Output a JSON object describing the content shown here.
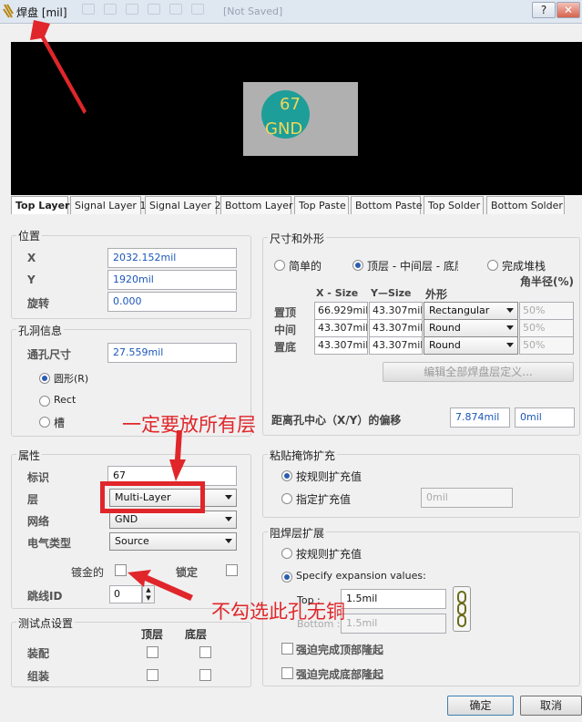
{
  "window": {
    "title": "焊盘 [mil]",
    "ghost_text": "[Not Saved]",
    "help": "?",
    "close": "✕"
  },
  "preview": {
    "designator": "67",
    "net": "GND"
  },
  "tabs": [
    "Top Layer",
    "Signal Layer 1",
    "Signal Layer 2",
    "Bottom Layer",
    "Top Paste",
    "Bottom Paste",
    "Top Solder",
    "Bottom Solder"
  ],
  "position": {
    "title": "位置",
    "x_label": "X",
    "x_value": "2032.152mil",
    "y_label": "Y",
    "y_value": "1920mil",
    "rot_label": "旋转",
    "rot_value": "0.000"
  },
  "hole": {
    "title": "孔洞信息",
    "size_label": "通孔尺寸",
    "size_value": "27.559mil",
    "shapes": [
      "圆形(R)",
      "Rect",
      "槽"
    ]
  },
  "props": {
    "title": "属性",
    "designator_label": "标识",
    "designator_value": "67",
    "layer_label": "层",
    "layer_value": "Multi-Layer",
    "net_label": "网络",
    "net_value": "GND",
    "etype_label": "电气类型",
    "etype_value": "Source",
    "plated_label": "镀金的",
    "locked_label": "锁定",
    "jumper_label": "跳线ID",
    "jumper_value": "0"
  },
  "testpoint": {
    "title": "测试点设置",
    "top_col": "顶层",
    "bottom_col": "底层",
    "assembly_label": "装配",
    "group_label": "组装"
  },
  "size_shape": {
    "title": "尺寸和外形",
    "opt_simple": "简单的",
    "opt_tmb": "顶层 - 中间层 - 底层",
    "opt_full": "完成堆栈",
    "corner_header": "角半径(%)",
    "col_x": "X - Size",
    "col_y": "Y—Size",
    "col_shape": "外形",
    "rows": [
      {
        "label": "置顶",
        "x": "66.929mil",
        "y": "43.307mil",
        "shape": "Rectangular",
        "corner": "50%"
      },
      {
        "label": "中间",
        "x": "43.307mil",
        "y": "43.307mil",
        "shape": "Round",
        "corner": "50%"
      },
      {
        "label": "置底",
        "x": "43.307mil",
        "y": "43.307mil",
        "shape": "Round",
        "corner": "50%"
      }
    ],
    "edit_btn": "编辑全部焊盘层定义...",
    "offset_label": "距离孔中心（X/Y）的偏移",
    "offset_x": "7.874mil",
    "offset_y": "0mil"
  },
  "paste": {
    "title": "粘贴掩饰扩充",
    "by_rule": "按规则扩充值",
    "specify": "指定扩充值",
    "value": "0mil"
  },
  "solder": {
    "title": "阻焊层扩展",
    "by_rule": "按规则扩充值",
    "specify": "Specify expansion values:",
    "top_label": "Top :",
    "top_value": "1.5mil",
    "bottom_label": "Bottom :",
    "bottom_value": "1.5mil",
    "force_top": "强迫完成顶部隆起",
    "force_bottom": "强迫完成底部隆起"
  },
  "buttons": {
    "ok": "确定",
    "cancel": "取消"
  },
  "annotations": {
    "note1": "一定要放所有层",
    "note2": "不勾选此孔无铜"
  },
  "colors": {
    "accent": "#e0262a",
    "pad_fill": "#1e9e98"
  }
}
